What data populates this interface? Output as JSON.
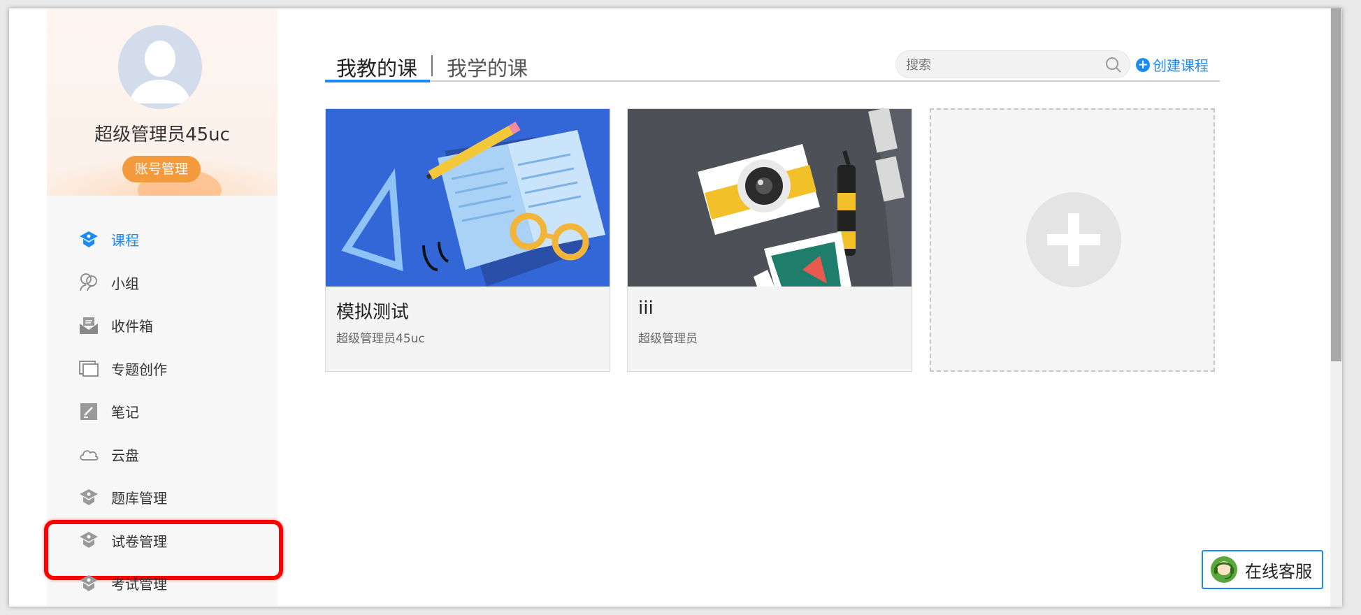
{
  "profile": {
    "name": "超级管理员45uc",
    "account_button": "账号管理"
  },
  "nav": {
    "items": [
      {
        "label": "课程",
        "icon": "course-icon",
        "active": true
      },
      {
        "label": "小组",
        "icon": "group-icon"
      },
      {
        "label": "收件箱",
        "icon": "inbox-icon"
      },
      {
        "label": "专题创作",
        "icon": "topic-icon"
      },
      {
        "label": "笔记",
        "icon": "note-icon"
      },
      {
        "label": "云盘",
        "icon": "cloud-icon"
      },
      {
        "label": "题库管理",
        "icon": "question-bank-icon"
      },
      {
        "label": "试卷管理",
        "icon": "exam-paper-icon",
        "highlighted": true
      },
      {
        "label": "考试管理",
        "icon": "exam-icon"
      }
    ]
  },
  "tabs": {
    "teach": "我教的课",
    "learn": "我学的课"
  },
  "search": {
    "placeholder": "搜索"
  },
  "create_course": "创建课程",
  "courses": [
    {
      "title": "模拟测试",
      "author": "超级管理员45uc"
    },
    {
      "title": "iii",
      "author": "超级管理员"
    }
  ],
  "online_service": "在线客服",
  "colors": {
    "accent": "#1a8bf5",
    "account_button": "#f39a3c",
    "highlight_box": "#ff0000"
  }
}
